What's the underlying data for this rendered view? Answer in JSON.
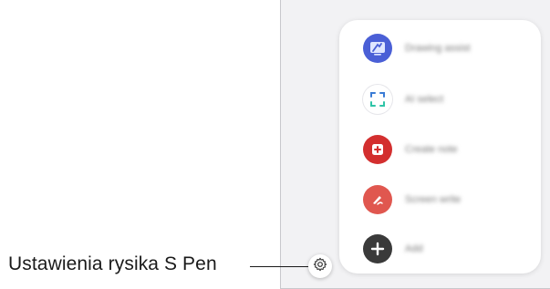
{
  "menu": {
    "items": [
      {
        "label": "Drawing assist",
        "icon": "drawing-assist-icon",
        "color": "#4a5fd6"
      },
      {
        "label": "AI select",
        "icon": "ai-select-icon",
        "color": "#ffffff"
      },
      {
        "label": "Create note",
        "icon": "create-note-icon",
        "color": "#d32f2f"
      },
      {
        "label": "Screen write",
        "icon": "screen-write-icon",
        "color": "#e0574f"
      },
      {
        "label": "Add",
        "icon": "add-icon",
        "color": "#3a3a3a"
      }
    ]
  },
  "callout": {
    "label": "Ustawienia rysika S Pen"
  },
  "settings": {
    "icon": "gear-icon"
  }
}
